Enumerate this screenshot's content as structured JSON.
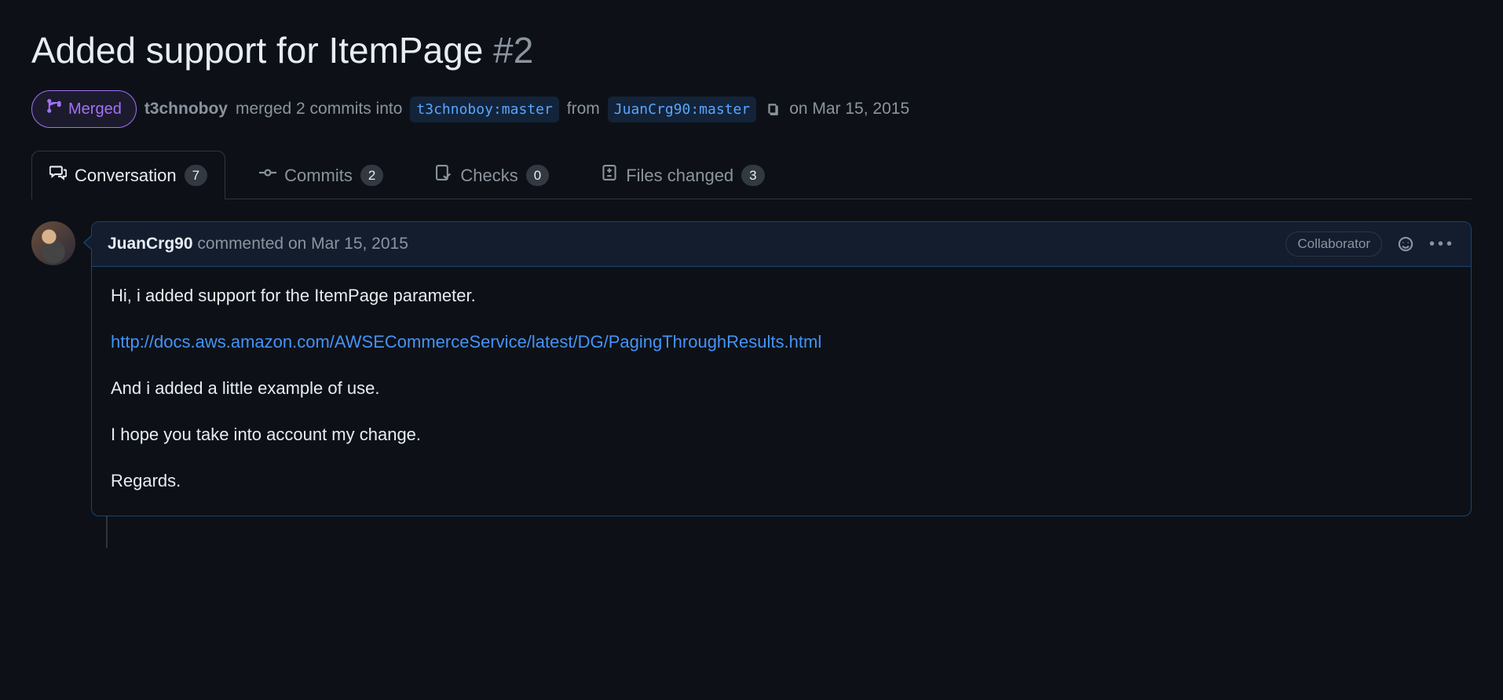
{
  "header": {
    "title": "Added support for ItemPage",
    "number": "#2"
  },
  "state": {
    "label": "Merged",
    "actor": "t3chnoboy",
    "action_prefix": "merged 2 commits into",
    "base_branch": "t3chnoboy:master",
    "from_word": "from",
    "head_branch": "JuanCrg90:master",
    "date": "on Mar 15, 2015"
  },
  "tabs": {
    "conversation": {
      "label": "Conversation",
      "count": "7"
    },
    "commits": {
      "label": "Commits",
      "count": "2"
    },
    "checks": {
      "label": "Checks",
      "count": "0"
    },
    "files": {
      "label": "Files changed",
      "count": "3"
    }
  },
  "comment": {
    "author": "JuanCrg90",
    "verb": "commented",
    "date": "on Mar 15, 2015",
    "role": "Collaborator",
    "body": {
      "p1": "Hi, i added support for the ItemPage parameter.",
      "link": "http://docs.aws.amazon.com/AWSECommerceService/latest/DG/PagingThroughResults.html",
      "p2": "And i added a little example of use.",
      "p3": "I hope you take into account my change.",
      "p4": "Regards."
    }
  }
}
